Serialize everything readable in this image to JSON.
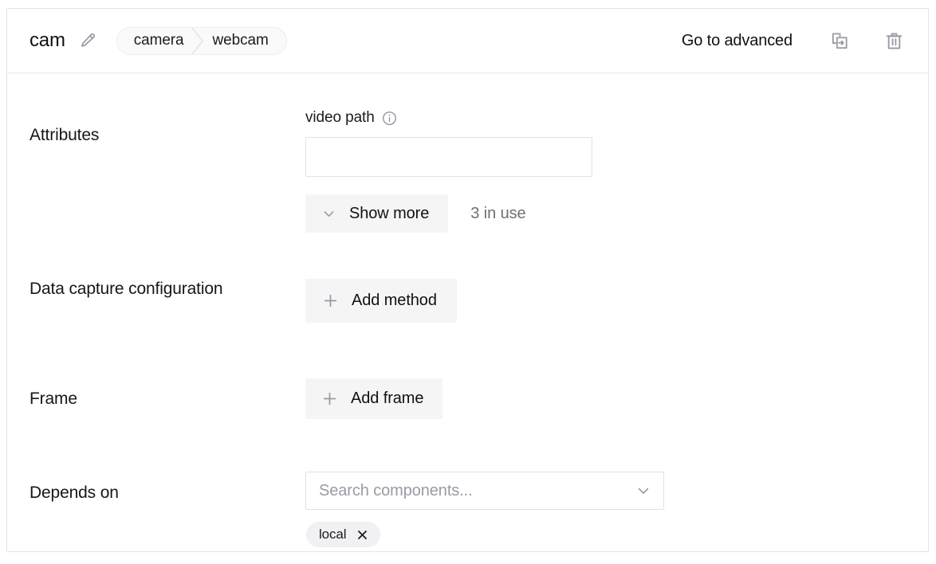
{
  "header": {
    "title": "cam",
    "edit_icon": "pencil-icon",
    "breadcrumb": {
      "parent": "camera",
      "child": "webcam"
    },
    "advanced_label": "Go to advanced",
    "duplicate_icon": "duplicate-icon",
    "delete_icon": "trash-icon"
  },
  "sections": {
    "attributes": {
      "label": "Attributes",
      "field_label": "video path",
      "info_icon": "info-icon",
      "input_value": "",
      "input_placeholder": "",
      "show_more_label": "Show more",
      "show_more_icon": "chevron-down-icon",
      "in_use_text": "3 in use"
    },
    "data_capture": {
      "label": "Data capture configuration",
      "add_method_label": "Add method",
      "add_icon": "plus-icon"
    },
    "frame": {
      "label": "Frame",
      "add_frame_label": "Add frame",
      "add_icon": "plus-icon"
    },
    "depends_on": {
      "label": "Depends on",
      "search_placeholder": "Search components...",
      "dropdown_icon": "chevron-down-icon",
      "chips": [
        {
          "label": "local",
          "close_icon": "close-icon"
        }
      ]
    }
  },
  "colors": {
    "card_border": "#e4e4e7",
    "button_bg": "#f5f5f6",
    "chip_bg": "#f1f1f3",
    "muted_text": "#6f6f76",
    "placeholder_text": "#9a9aa3",
    "icon_gray": "#9a9aa5",
    "text": "#111114"
  }
}
